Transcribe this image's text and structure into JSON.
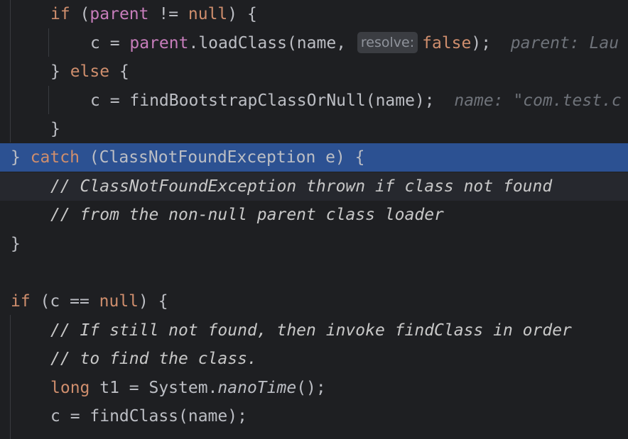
{
  "editor": {
    "lines": [
      {
        "kw1": "if",
        "p1": " (",
        "fld1": "parent",
        "p2": " != ",
        "kw2": "null",
        "p3": ") {"
      },
      {
        "p1": "c = ",
        "fld1": "parent",
        "p2": ".loadClass(name, ",
        "hint": "resolve:",
        "kw1": "false",
        "p3": ");",
        "inline": "parent: Lau"
      },
      {
        "p1": "} ",
        "kw1": "else",
        "p2": " {"
      },
      {
        "p1": "c = findBootstrapClassOrNull(name);",
        "inline": "name: \"com.test.c"
      },
      {
        "p1": "}"
      },
      {
        "p1": "} ",
        "kw1": "catch",
        "p2": " (ClassNotFoundException e) {"
      },
      {
        "cmt": "// ClassNotFoundException thrown if class not found"
      },
      {
        "cmt": "// from the non-null parent class loader"
      },
      {
        "p1": "}"
      },
      {
        "p1": ""
      },
      {
        "kw1": "if",
        "p1": " (c == ",
        "kw2": "null",
        "p2": ") {"
      },
      {
        "cmt": "// If still not found, then invoke findClass in order"
      },
      {
        "cmt": "// to find the class."
      },
      {
        "kw1": "long",
        "p1": " t1 = System.",
        "ital": "nanoTime",
        "p2": "();"
      },
      {
        "p1": "c = findClass(name);"
      }
    ]
  }
}
